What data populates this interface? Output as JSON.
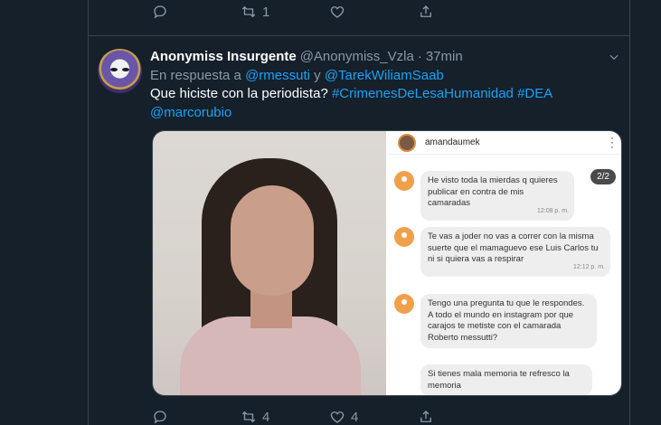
{
  "previous_tweet": {
    "reply_count": "",
    "retweet_count": "1",
    "like_count": ""
  },
  "tweet": {
    "name": "Anonymiss Insurgente",
    "handle": "@Anonymiss_Vzla",
    "sep": "·",
    "time": "37min",
    "reply_prefix": "En respuesta a",
    "reply_user1": "@rmessuti",
    "reply_joiner": "y",
    "reply_user2": "@TarekWiliamSaab",
    "text_plain": "Que hiciste con la periodista?",
    "hashtag1": "#CrimenesDeLesaHumanidad",
    "hashtag2": "#DEA",
    "mention": "@marcorubio",
    "reply_count": "",
    "retweet_count": "4",
    "like_count": "4"
  },
  "chat": {
    "username": "amandaumek",
    "page_badge": "2/2",
    "messages": [
      {
        "text": "He visto toda la mierdas q quieres publicar en contra de mis camaradas",
        "time": "12:08 p. m."
      },
      {
        "text": "Te vas a joder no vas a correr con la misma suerte que el mamaguevo ese Luis Carlos tu ni si quiera vas a respirar",
        "time": "12:12 p. m."
      },
      {
        "text": "Tengo una pregunta tu que le respondes. A todo el mundo en instagram por que carajos te metiste con el camarada Roberto messutti?",
        "time": ""
      },
      {
        "text": "Si tienes mala memoria te refresco la memoria",
        "time": ""
      }
    ]
  },
  "icons": {
    "reply": "reply-icon",
    "retweet": "retweet-icon",
    "like": "heart-icon",
    "share": "share-icon",
    "caret": "chevron-down-icon"
  },
  "colors": {
    "background": "#15202b",
    "link": "#1da1f2",
    "muted": "#8899a6",
    "border": "#38444d"
  }
}
